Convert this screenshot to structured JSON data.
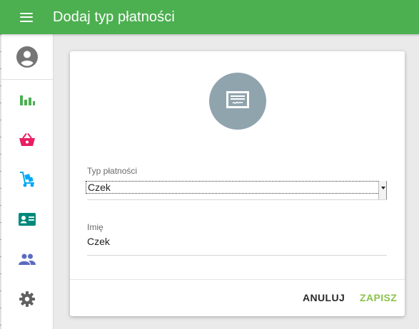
{
  "appbar": {
    "title": "Dodaj typ płatności",
    "color": "#4caf50"
  },
  "sidebar": {
    "items": [
      {
        "name": "account-icon",
        "color": "#757575"
      },
      {
        "name": "bar-chart-icon",
        "color": "#4caf50"
      },
      {
        "name": "shopping-basket-icon",
        "color": "#e91e63"
      },
      {
        "name": "hand-truck-icon",
        "color": "#03a9f4"
      },
      {
        "name": "contact-card-icon",
        "color": "#00897b"
      },
      {
        "name": "people-icon",
        "color": "#5c6bc0"
      },
      {
        "name": "settings-gear-icon",
        "color": "#616161"
      }
    ]
  },
  "form": {
    "icon": "check-payment-icon",
    "icon_bg": "#90a4ae",
    "payment_type_label": "Typ płatności",
    "payment_type_value": "Czek",
    "name_label": "Imię",
    "name_value": "Czek"
  },
  "actions": {
    "cancel": "ANULUJ",
    "save": "ZAPISZ",
    "save_color": "#8bc34a"
  }
}
